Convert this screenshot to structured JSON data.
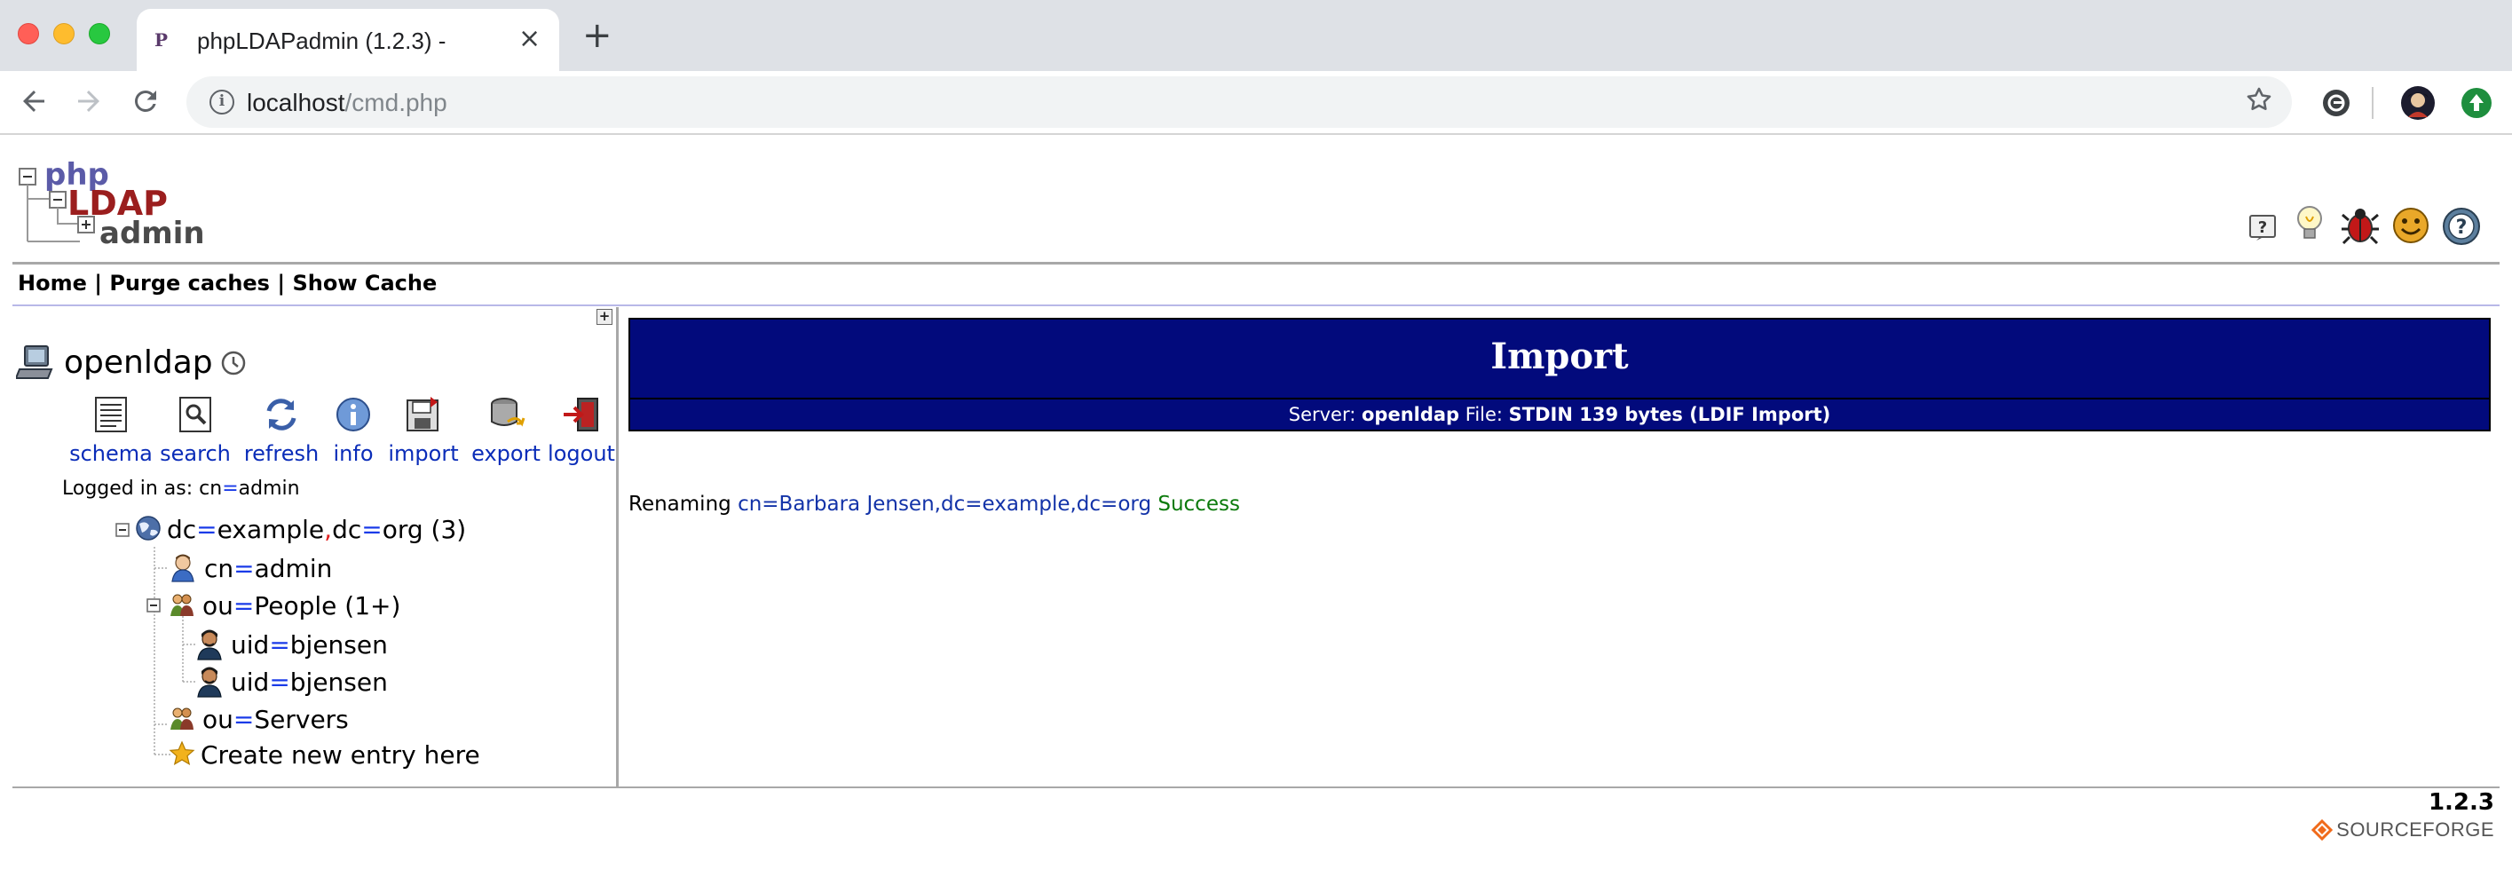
{
  "browser": {
    "tab_title": "phpLDAPadmin (1.2.3) -",
    "tab_favicon": "P",
    "tab_close": "×",
    "new_tab": "+",
    "url_host": "localhost",
    "url_path": "/cmd.php",
    "icons": [
      "back-icon",
      "forward-icon",
      "reload-icon",
      "info-icon",
      "star-icon",
      "extension-icon",
      "profile-avatar",
      "update-icon"
    ]
  },
  "app": {
    "logo_lines": [
      "php",
      "LDAP",
      "admin"
    ],
    "help_icons": [
      "help-icon",
      "lightbulb-icon",
      "bug-icon",
      "smiley-icon",
      "question-icon"
    ],
    "menu": [
      "Home",
      "Purge caches",
      "Show Cache"
    ],
    "menu_separator": " | ",
    "collapse_button": "+"
  },
  "server": {
    "name": "openldap",
    "actions": [
      {
        "label": "schema",
        "icon": "schema-icon"
      },
      {
        "label": "search",
        "icon": "search-icon"
      },
      {
        "label": "refresh",
        "icon": "refresh-icon"
      },
      {
        "label": "info",
        "icon": "info-icon"
      },
      {
        "label": "import",
        "icon": "import-icon"
      },
      {
        "label": "export",
        "icon": "export-icon"
      },
      {
        "label": "logout",
        "icon": "logout-icon"
      }
    ],
    "logged_in_label": "Logged in as: ",
    "logged_in_user": {
      "attr": "cn",
      "val": "admin"
    }
  },
  "tree": {
    "root": {
      "a1": "dc",
      "v1": "example",
      "a2": "dc",
      "v2": "org",
      "count": " (3)"
    },
    "admin": {
      "attr": "cn",
      "val": "admin"
    },
    "people": {
      "attr": "ou",
      "val": "People",
      "count": " (1+)"
    },
    "user1": {
      "attr": "uid",
      "val": "bjensen"
    },
    "user2": {
      "attr": "uid",
      "val": "bjensen"
    },
    "servers": {
      "attr": "ou",
      "val": "Servers"
    },
    "create": "Create new entry here"
  },
  "import": {
    "title": "Import",
    "server_label": "Server: ",
    "server_value": "openldap",
    "file_label": " File: ",
    "file_value": "STDIN 139 bytes (LDIF Import)",
    "result_action": "Renaming ",
    "result_dn": "cn=Barbara Jensen,dc=example,dc=org",
    "result_status": " Success"
  },
  "footer": {
    "version": "1.2.3",
    "sourceforge": "SOURCEFORGE"
  }
}
